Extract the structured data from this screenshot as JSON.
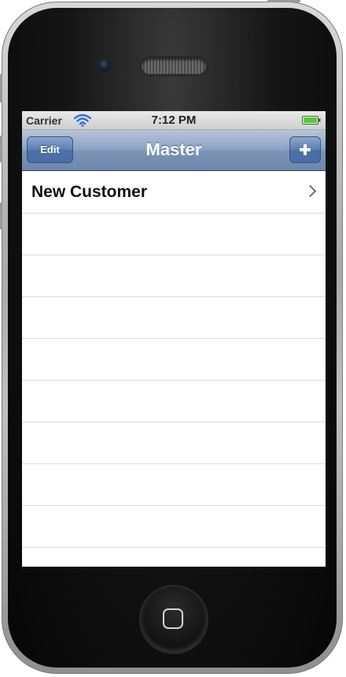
{
  "status_bar": {
    "carrier": "Carrier",
    "time": "7:12 PM",
    "wifi_icon": "wifi-icon",
    "battery_icon": "battery-icon",
    "battery_color": "#4cd136"
  },
  "nav_bar": {
    "title": "Master",
    "edit_label": "Edit",
    "add_icon": "plus-icon",
    "tint_color": "#6d86ab"
  },
  "table": {
    "rows": [
      {
        "label": "New Customer",
        "accessory": "chevron-right-icon"
      }
    ],
    "empty_rows": 8
  },
  "device": {
    "home_icon": "home-button-icon"
  }
}
